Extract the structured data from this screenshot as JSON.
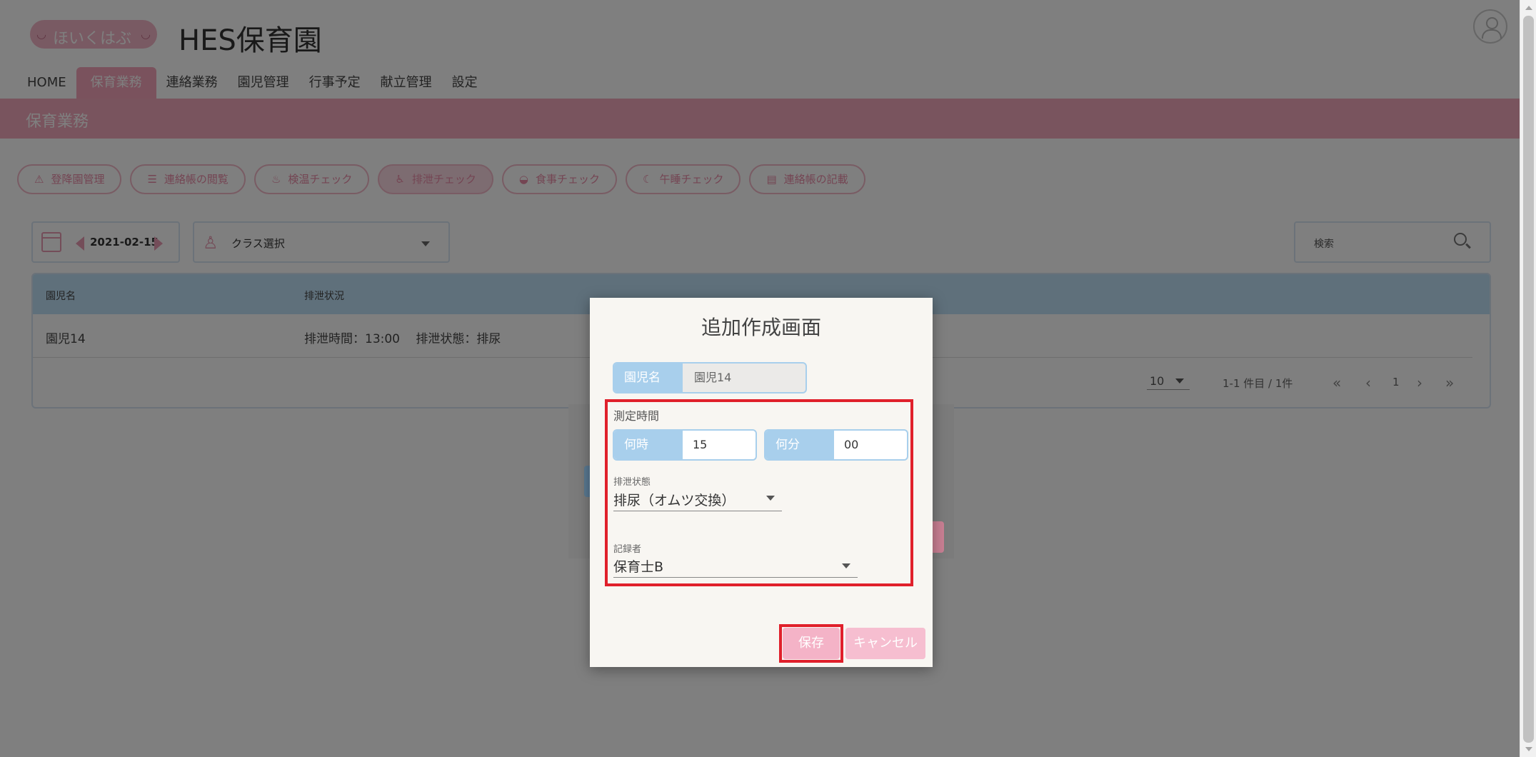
{
  "app": {
    "logo_text": "ほいくはぶ",
    "title": "HES保育園"
  },
  "nav": {
    "items": [
      {
        "label": "HOME"
      },
      {
        "label": "保育業務"
      },
      {
        "label": "連絡業務"
      },
      {
        "label": "園児管理"
      },
      {
        "label": "行事予定"
      },
      {
        "label": "献立管理"
      },
      {
        "label": "設定"
      }
    ],
    "active_index": 1
  },
  "section": {
    "title": "保育業務"
  },
  "tools": [
    {
      "label": "登降園管理",
      "icon": "warning-icon"
    },
    {
      "label": "連絡帳の閲覧",
      "icon": "list-icon"
    },
    {
      "label": "検温チェック",
      "icon": "thermometer-icon"
    },
    {
      "label": "排泄チェック",
      "icon": "toilet-icon"
    },
    {
      "label": "食事チェック",
      "icon": "bowl-icon"
    },
    {
      "label": "午睡チェック",
      "icon": "sleep-icon"
    },
    {
      "label": "連絡帳の記載",
      "icon": "notebook-icon"
    }
  ],
  "filters": {
    "date": "2021-02-15",
    "class_placeholder": "クラス選択",
    "search_placeholder": "検索"
  },
  "table": {
    "headers": [
      "園児名",
      "排泄状況"
    ],
    "rows": [
      {
        "name": "園児14",
        "status": "排泄時間：13:00　 排泄状態：排尿"
      }
    ],
    "per_page": "10",
    "range_text": "1-1 件目 / 1件",
    "current_page": "1"
  },
  "modal": {
    "title": "追加作成画面",
    "child_label": "園児名",
    "child_value": "園児14",
    "time_section_label": "測定時間",
    "hour_label": "何時",
    "hour_value": "15",
    "minute_label": "何分",
    "minute_value": "00",
    "excretion_label": "排泄状態",
    "excretion_value": "排尿（オムツ交換）",
    "recorder_label": "記録者",
    "recorder_value": "保育士B",
    "save_label": "保存",
    "cancel_label": "キャンセル"
  },
  "colors": {
    "brand_pink": "#f3a9bd",
    "accent_blue": "#a8cfec",
    "highlight_red": "#e0202b"
  }
}
